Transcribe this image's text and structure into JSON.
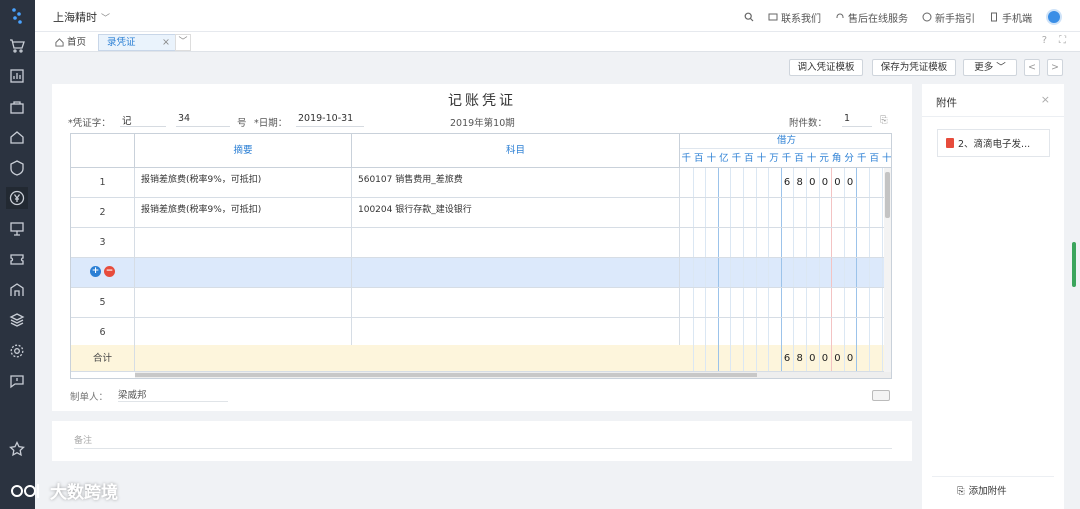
{
  "company": {
    "name": "上海精时"
  },
  "toplinks": [
    {
      "label": "联系我们"
    },
    {
      "label": "售后在线服务"
    },
    {
      "label": "新手指引"
    },
    {
      "label": "手机端"
    }
  ],
  "tabs": {
    "home": "首页",
    "active": "录凭证",
    "close": "×"
  },
  "toolbar": {
    "load_template": "调入凭证模板",
    "save_template": "保存为凭证模板",
    "more": "更多",
    "prev": "<",
    "next": ">"
  },
  "voucher": {
    "title": "记账凭证",
    "word_label": "*凭证字：",
    "word_value": "记",
    "number_value": "34",
    "number_suffix": "号",
    "date_label": "*日期：",
    "date_value": "2019-10-31",
    "period": "2019年第10期",
    "attach_label": "附件数：",
    "attach_value": "1"
  },
  "table": {
    "headers": {
      "summary": "摘要",
      "account": "科目",
      "debit": "借方"
    },
    "digits": [
      "千",
      "百",
      "十",
      "亿",
      "千",
      "百",
      "十",
      "万",
      "千",
      "百",
      "十",
      "元",
      "角",
      "分",
      "千",
      "百",
      "十"
    ],
    "rows": [
      {
        "no": "1",
        "summary": "报销差旅费(税率9%，可抵扣)",
        "account": "560107 销售费用_差旅费",
        "amount": [
          "6",
          "8",
          "0",
          "0",
          "0",
          "0"
        ]
      },
      {
        "no": "2",
        "summary": "报销差旅费(税率9%，可抵扣)",
        "account": "100204 银行存款_建设银行",
        "amount": []
      },
      {
        "no": "3",
        "summary": "",
        "account": "",
        "amount": []
      },
      {
        "no": "",
        "summary": "",
        "account": "",
        "amount": []
      },
      {
        "no": "5",
        "summary": "",
        "account": "",
        "amount": []
      },
      {
        "no": "6",
        "summary": "",
        "account": "",
        "amount": []
      }
    ],
    "total_label": "合计",
    "total_amount": [
      "6",
      "8",
      "0",
      "0",
      "0",
      "0"
    ]
  },
  "footer": {
    "maker_label": "制单人：",
    "maker_value": "梁威邦",
    "notes_placeholder": "备注"
  },
  "attachments": {
    "title": "附件",
    "close": "×",
    "files": [
      {
        "name": "2、滴滴电子发..."
      }
    ],
    "add_label": "添加附件"
  },
  "watermark": {
    "text": "大数跨境"
  },
  "colors": {
    "nav_bg": "#2b3340",
    "accent": "#2b7fd4",
    "highlight_row": "#dce9fb",
    "total_row": "#fdf5dc"
  }
}
